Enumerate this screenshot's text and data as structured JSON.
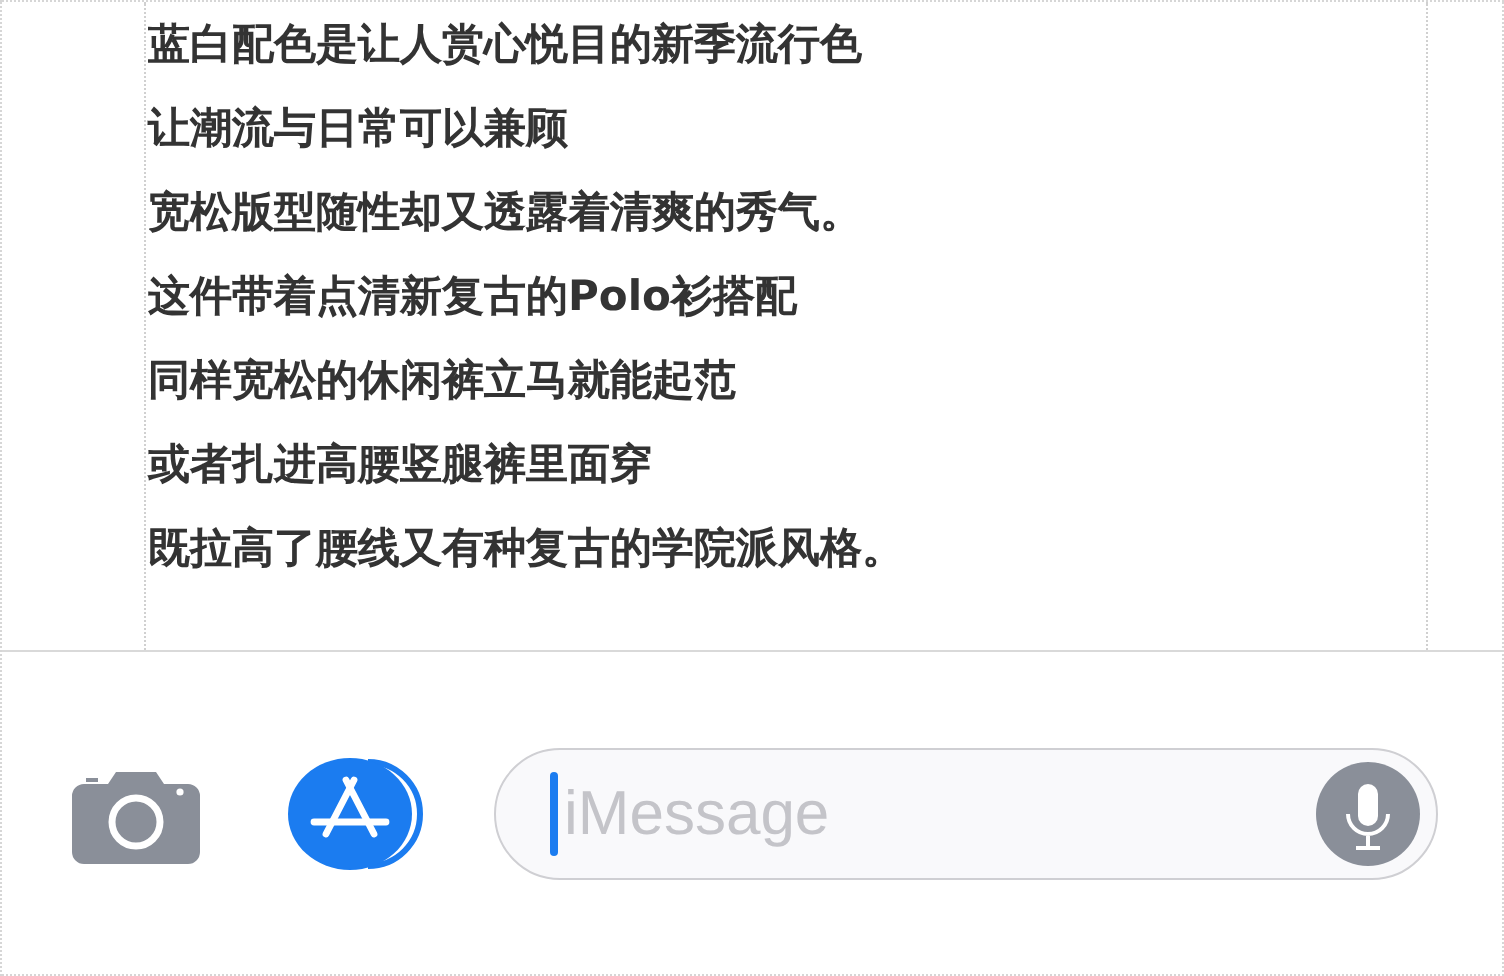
{
  "article": {
    "lines": [
      "蓝白配色是让人赏心悦目的新季流行色",
      "让潮流与日常可以兼顾",
      "宽松版型随性却又透露着清爽的秀气。",
      "这件带着点清新复古的Polo衫搭配",
      "同样宽松的休闲裤立马就能起范",
      "或者扎进高腰竖腿裤里面穿",
      "既拉高了腰线又有种复古的学院派风格。"
    ]
  },
  "compose_bar": {
    "message_field": {
      "placeholder": "iMessage"
    }
  }
}
